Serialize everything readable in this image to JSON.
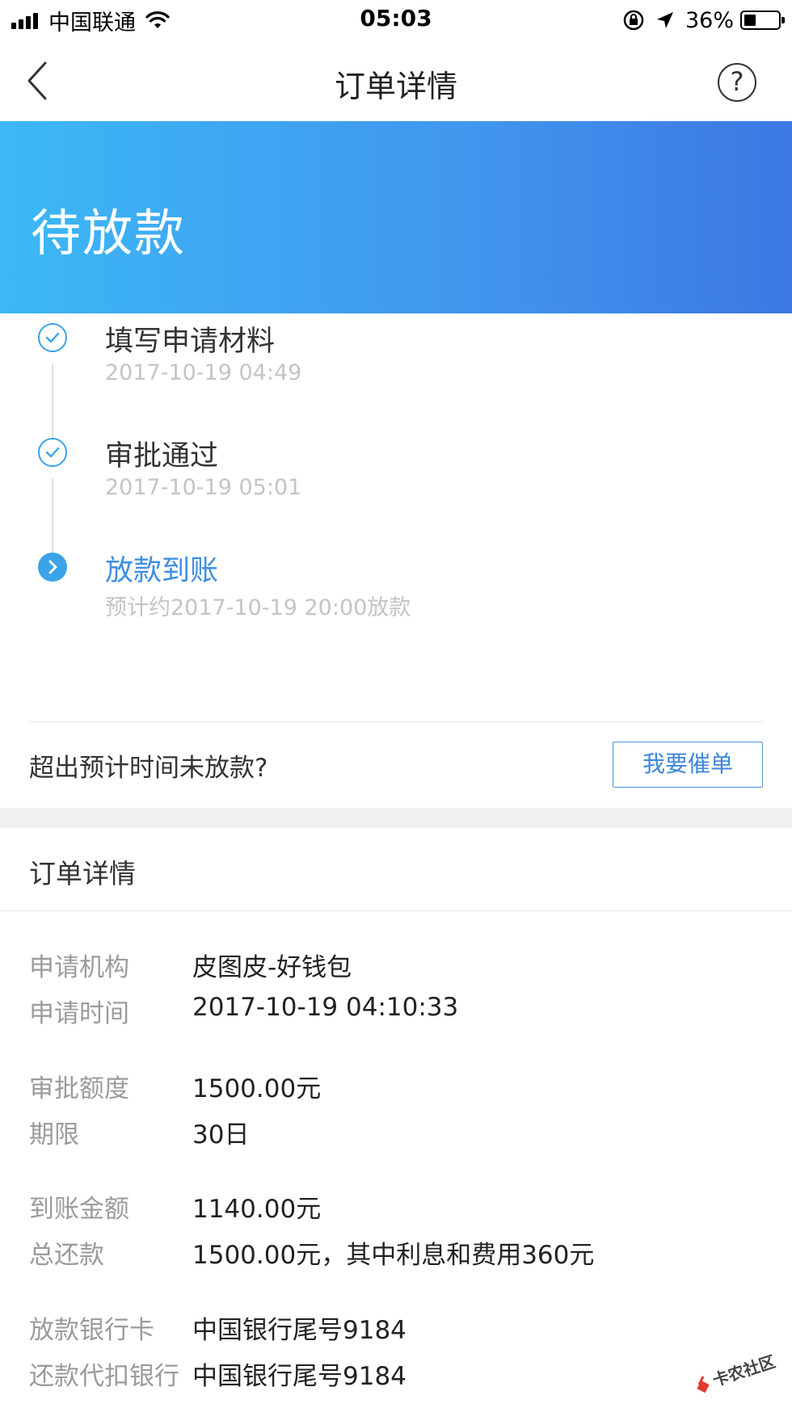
{
  "status_bar": {
    "carrier": "中国联通",
    "time": "05:03",
    "battery_percent": "36%",
    "battery_level": 0.36
  },
  "nav": {
    "title": "订单详情",
    "back_icon": "chevron-left-icon",
    "help_icon": "help-circle-icon",
    "help_glyph": "?"
  },
  "banner": {
    "status": "待放款",
    "gradient_from": "#3cb8f6",
    "gradient_to": "#3c78e2"
  },
  "timeline": {
    "steps": [
      {
        "title": "填写申请材料",
        "subtitle": "2017-10-19 04:49",
        "state": "done"
      },
      {
        "title": "审批通过",
        "subtitle": "2017-10-19 05:01",
        "state": "done"
      },
      {
        "title": "放款到账",
        "subtitle": "预计约2017-10-19 20:00放款",
        "state": "current"
      }
    ],
    "accent_color": "#3aa3e9"
  },
  "urge": {
    "prompt": "超出预计时间未放款?",
    "button_label": "我要催单"
  },
  "details": {
    "section_title": "订单详情",
    "rows": [
      {
        "label": "申请机构",
        "value": "皮图皮-好钱包"
      },
      {
        "label": "申请时间",
        "value": "2017-10-19 04:10:33"
      },
      {
        "label": "审批额度",
        "value": "1500.00元"
      },
      {
        "label": "期限",
        "value": "30日"
      },
      {
        "label": "到账金额",
        "value": "1140.00元"
      },
      {
        "label": "总还款",
        "value": "1500.00元，其中利息和费用360元"
      },
      {
        "label": "放款银行卡",
        "value": "中国银行尾号9184"
      },
      {
        "label": "还款代扣银行",
        "value": "中国银行尾号9184"
      }
    ]
  },
  "watermark": {
    "text": "卡农社区"
  }
}
